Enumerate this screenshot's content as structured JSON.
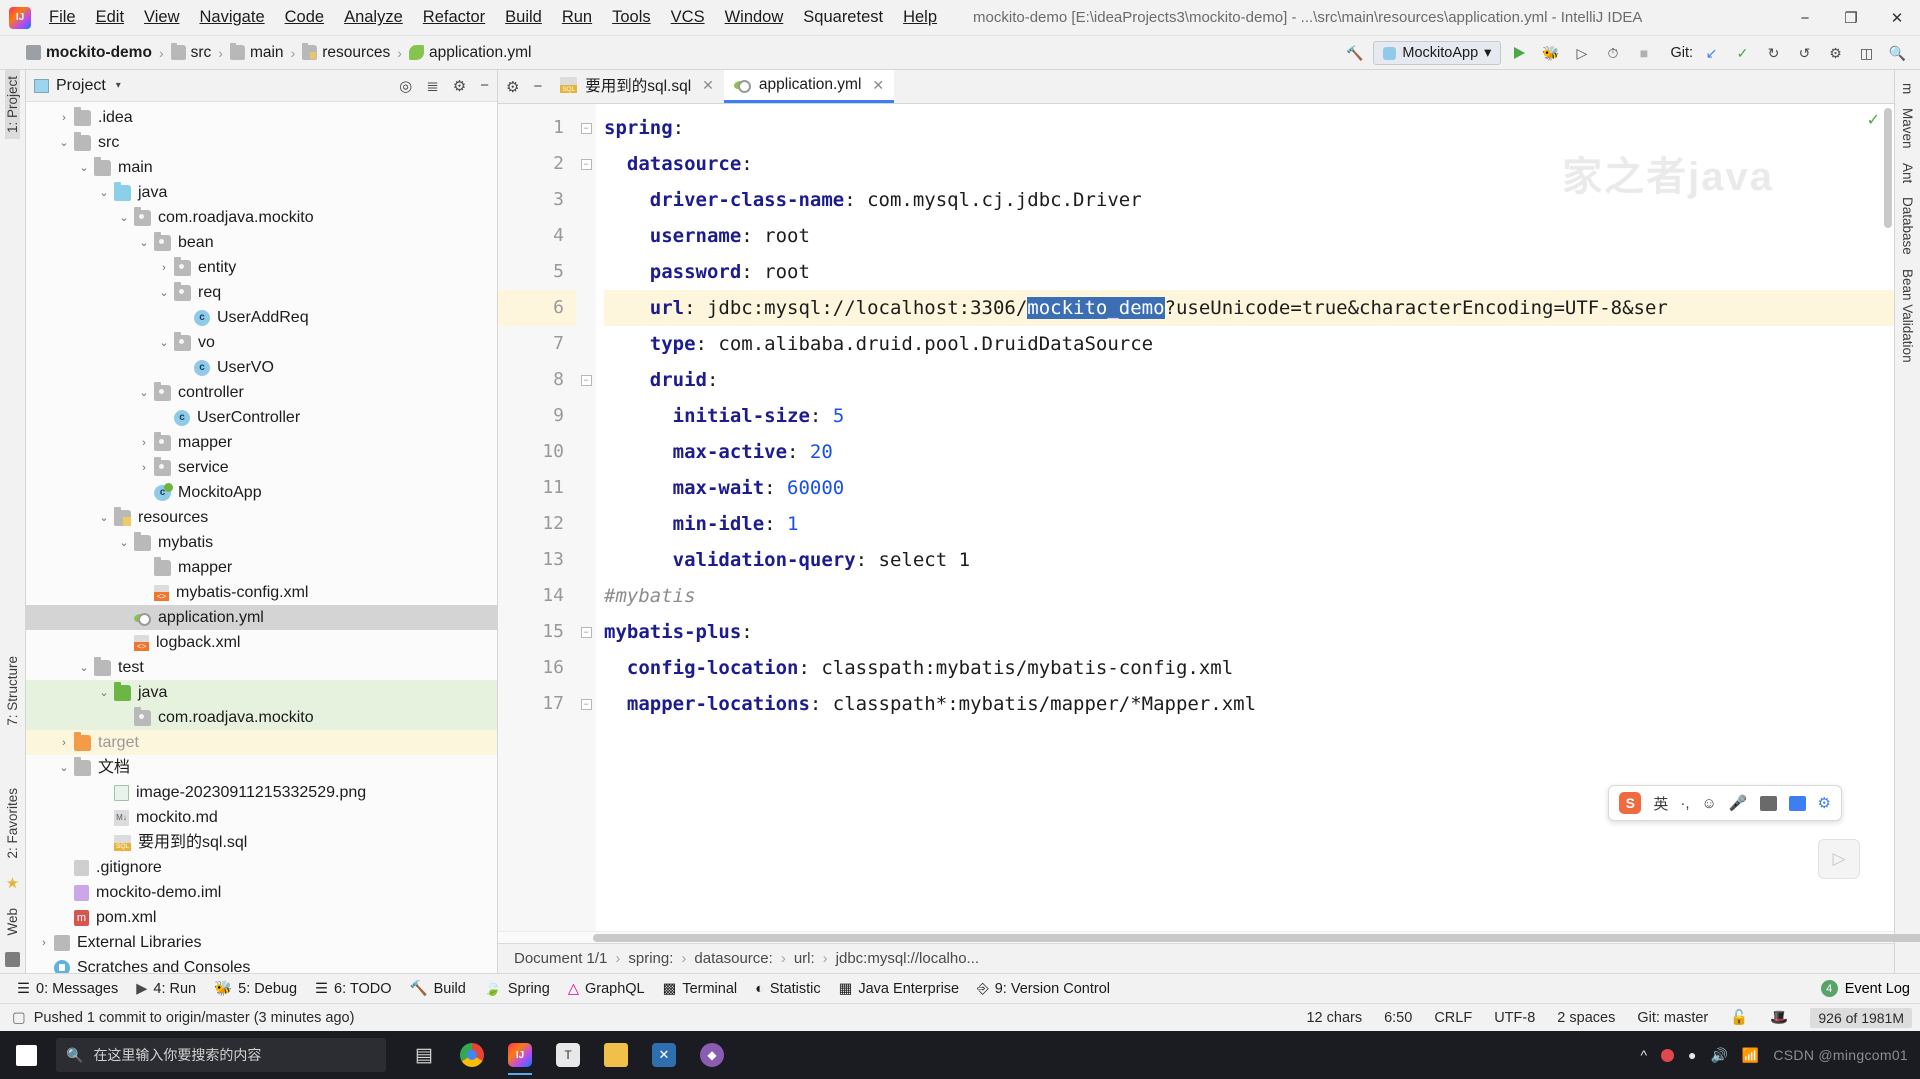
{
  "window": {
    "title": "mockito-demo [E:\\ideaProjects3\\mockito-demo] - ...\\src\\main\\resources\\application.yml - IntelliJ IDEA",
    "minimize": "−",
    "maximize": "❐",
    "close": "✕",
    "logo": "intellij-idea-logo"
  },
  "menu": {
    "items": [
      {
        "label": "File"
      },
      {
        "label": "Edit"
      },
      {
        "label": "View"
      },
      {
        "label": "Navigate"
      },
      {
        "label": "Code"
      },
      {
        "label": "Analyze"
      },
      {
        "label": "Refactor"
      },
      {
        "label": "Build"
      },
      {
        "label": "Run"
      },
      {
        "label": "Tools"
      },
      {
        "label": "VCS"
      },
      {
        "label": "Window"
      },
      {
        "label": "Squaretest"
      },
      {
        "label": "Help"
      }
    ]
  },
  "navbar": {
    "crumbs": [
      {
        "label": "mockito-demo",
        "icon": "project-folder-icon"
      },
      {
        "label": "src",
        "icon": "folder-icon"
      },
      {
        "label": "main",
        "icon": "folder-icon"
      },
      {
        "label": "resources",
        "icon": "resources-folder-icon"
      },
      {
        "label": "application.yml",
        "icon": "yml-file-icon"
      }
    ],
    "separator": "›",
    "run_config": "MockitoApp",
    "run_config_caret": "▾",
    "git_label": "Git:",
    "buttons": {
      "run": "run-button",
      "debug": "debug-button",
      "coverage": "run-with-coverage-button",
      "profiler": "profiler-button",
      "stop": "stop-button",
      "update": "update-project-button",
      "commit": "commit-button",
      "history": "history-button",
      "rollback": "rollback-button",
      "settings": "settings-button",
      "layout": "layout-button",
      "search": "search-everywhere-button"
    }
  },
  "left_rail": {
    "items": [
      {
        "label": "1: Project",
        "selected": true
      },
      {
        "label": "7: Structure",
        "selected": false
      },
      {
        "label": "2: Favorites",
        "selected": false
      },
      {
        "label": "Web",
        "selected": false
      }
    ]
  },
  "right_rail": {
    "items": [
      {
        "label": "m"
      },
      {
        "label": "Maven"
      },
      {
        "label": "Ant"
      },
      {
        "label": "Database"
      },
      {
        "label": "Bean Validation"
      }
    ]
  },
  "project_panel": {
    "title": "Project",
    "chevron": "▾",
    "icons": [
      "target-icon",
      "collapse-all-icon",
      "settings-gear-icon",
      "hide-icon"
    ],
    "tree": [
      {
        "indent": 1,
        "twisty": "›",
        "icon": "f-grey",
        "label": ".idea",
        "state": ""
      },
      {
        "indent": 1,
        "twisty": "⌄",
        "icon": "f-grey",
        "label": "src",
        "state": ""
      },
      {
        "indent": 2,
        "twisty": "⌄",
        "icon": "f-grey",
        "label": "main",
        "state": ""
      },
      {
        "indent": 3,
        "twisty": "⌄",
        "icon": "f-blue",
        "label": "java",
        "state": ""
      },
      {
        "indent": 4,
        "twisty": "⌄",
        "icon": "f-pkg",
        "label": "com.roadjava.mockito",
        "state": ""
      },
      {
        "indent": 5,
        "twisty": "⌄",
        "icon": "f-pkg",
        "label": "bean",
        "state": ""
      },
      {
        "indent": 6,
        "twisty": "›",
        "icon": "f-pkg",
        "label": "entity",
        "state": ""
      },
      {
        "indent": 6,
        "twisty": "⌄",
        "icon": "f-pkg",
        "label": "req",
        "state": ""
      },
      {
        "indent": 7,
        "twisty": "",
        "icon": "c-class",
        "label": "UserAddReq",
        "state": ""
      },
      {
        "indent": 6,
        "twisty": "⌄",
        "icon": "f-pkg",
        "label": "vo",
        "state": ""
      },
      {
        "indent": 7,
        "twisty": "",
        "icon": "c-class",
        "label": "UserVO",
        "state": ""
      },
      {
        "indent": 5,
        "twisty": "⌄",
        "icon": "f-pkg",
        "label": "controller",
        "state": ""
      },
      {
        "indent": 6,
        "twisty": "",
        "icon": "c-class",
        "label": "UserController",
        "state": ""
      },
      {
        "indent": 5,
        "twisty": "›",
        "icon": "f-pkg",
        "label": "mapper",
        "state": ""
      },
      {
        "indent": 5,
        "twisty": "›",
        "icon": "f-pkg",
        "label": "service",
        "state": ""
      },
      {
        "indent": 5,
        "twisty": "",
        "icon": "c-spring",
        "label": "MockitoApp",
        "state": ""
      },
      {
        "indent": 3,
        "twisty": "⌄",
        "icon": "f-res",
        "label": "resources",
        "state": ""
      },
      {
        "indent": 4,
        "twisty": "⌄",
        "icon": "f-grey",
        "label": "mybatis",
        "state": ""
      },
      {
        "indent": 5,
        "twisty": "",
        "icon": "f-grey",
        "label": "mapper",
        "state": ""
      },
      {
        "indent": 5,
        "twisty": "",
        "icon": "x-xml",
        "label": "mybatis-config.xml",
        "state": ""
      },
      {
        "indent": 4,
        "twisty": "",
        "icon": "y-yml",
        "label": "application.yml",
        "state": "selected"
      },
      {
        "indent": 4,
        "twisty": "",
        "icon": "x-xml",
        "label": "logback.xml",
        "state": ""
      },
      {
        "indent": 2,
        "twisty": "⌄",
        "icon": "f-grey",
        "label": "test",
        "state": ""
      },
      {
        "indent": 3,
        "twisty": "⌄",
        "icon": "f-green",
        "label": "java",
        "state": "green"
      },
      {
        "indent": 4,
        "twisty": "",
        "icon": "f-pkg",
        "label": "com.roadjava.mockito",
        "state": "green"
      },
      {
        "indent": 1,
        "twisty": "›",
        "icon": "f-orange",
        "label": "target",
        "state": "yellow",
        "dim": true
      },
      {
        "indent": 1,
        "twisty": "⌄",
        "icon": "f-grey",
        "label": "文档",
        "state": ""
      },
      {
        "indent": 3,
        "twisty": "",
        "icon": "i-png",
        "label": "image-20230911215332529.png",
        "state": ""
      },
      {
        "indent": 3,
        "twisty": "",
        "icon": "i-md",
        "label": "mockito.md",
        "state": ""
      },
      {
        "indent": 3,
        "twisty": "",
        "icon": "i-sql",
        "label": "要用到的sql.sql",
        "state": ""
      },
      {
        "indent": 1,
        "twisty": "",
        "icon": "i-git",
        "label": ".gitignore",
        "state": ""
      },
      {
        "indent": 1,
        "twisty": "",
        "icon": "i-iml",
        "label": "mockito-demo.iml",
        "state": ""
      },
      {
        "indent": 1,
        "twisty": "",
        "icon": "i-pom",
        "label": "pom.xml",
        "state": ""
      },
      {
        "indent": 0,
        "twisty": "›",
        "icon": "i-lib",
        "label": "External Libraries",
        "state": ""
      },
      {
        "indent": 0,
        "twisty": "",
        "icon": "i-scratch",
        "label": "Scratches and Consoles",
        "state": ""
      }
    ]
  },
  "editor": {
    "tabs": [
      {
        "label": "要用到的sql.sql",
        "icon": "sql-file-icon",
        "active": false,
        "close": "✕"
      },
      {
        "label": "application.yml",
        "icon": "yml-file-icon",
        "active": true,
        "close": "✕"
      }
    ],
    "tab_tools": {
      "settings": "⚙",
      "hide": "−"
    },
    "watermark": "家之者java",
    "inspection_ok": "✓",
    "line_numbers": [
      1,
      2,
      3,
      4,
      5,
      6,
      7,
      8,
      9,
      10,
      11,
      12,
      13,
      14,
      15,
      16,
      17
    ],
    "current_line": 6,
    "fold_lines": [
      1,
      2,
      8,
      15,
      17
    ],
    "lines": [
      {
        "n": 1,
        "segments": [
          {
            "t": "spring",
            "c": "k"
          },
          {
            "t": ":",
            "c": ""
          }
        ],
        "indent": 0
      },
      {
        "n": 2,
        "segments": [
          {
            "t": "datasource",
            "c": "k"
          },
          {
            "t": ":",
            "c": ""
          }
        ],
        "indent": 1
      },
      {
        "n": 3,
        "segments": [
          {
            "t": "driver-class-name",
            "c": "k"
          },
          {
            "t": ": com.mysql.cj.jdbc.Driver",
            "c": ""
          }
        ],
        "indent": 2
      },
      {
        "n": 4,
        "segments": [
          {
            "t": "username",
            "c": "k"
          },
          {
            "t": ": root",
            "c": ""
          }
        ],
        "indent": 2
      },
      {
        "n": 5,
        "segments": [
          {
            "t": "password",
            "c": "k"
          },
          {
            "t": ": root",
            "c": ""
          }
        ],
        "indent": 2
      },
      {
        "n": 6,
        "segments": [
          {
            "t": "url",
            "c": "k"
          },
          {
            "t": ": jdbc:mysql://localhost:3306/",
            "c": ""
          },
          {
            "t": "mockito_demo",
            "c": "sel"
          },
          {
            "t": "?useUnicode=true&characterEncoding=UTF-8&ser",
            "c": ""
          }
        ],
        "indent": 2
      },
      {
        "n": 7,
        "segments": [
          {
            "t": "type",
            "c": "k"
          },
          {
            "t": ": com.alibaba.druid.pool.DruidDataSource",
            "c": ""
          }
        ],
        "indent": 2
      },
      {
        "n": 8,
        "segments": [
          {
            "t": "druid",
            "c": "k"
          },
          {
            "t": ":",
            "c": ""
          }
        ],
        "indent": 2
      },
      {
        "n": 9,
        "segments": [
          {
            "t": "initial-size",
            "c": "k"
          },
          {
            "t": ": ",
            "c": ""
          },
          {
            "t": "5",
            "c": "num"
          }
        ],
        "indent": 3
      },
      {
        "n": 10,
        "segments": [
          {
            "t": "max-active",
            "c": "k"
          },
          {
            "t": ": ",
            "c": ""
          },
          {
            "t": "20",
            "c": "num"
          }
        ],
        "indent": 3
      },
      {
        "n": 11,
        "segments": [
          {
            "t": "max-wait",
            "c": "k"
          },
          {
            "t": ": ",
            "c": ""
          },
          {
            "t": "60000",
            "c": "num"
          }
        ],
        "indent": 3
      },
      {
        "n": 12,
        "segments": [
          {
            "t": "min-idle",
            "c": "k"
          },
          {
            "t": ": ",
            "c": ""
          },
          {
            "t": "1",
            "c": "num"
          }
        ],
        "indent": 3
      },
      {
        "n": 13,
        "segments": [
          {
            "t": "validation-query",
            "c": "k"
          },
          {
            "t": ": select 1",
            "c": ""
          }
        ],
        "indent": 3
      },
      {
        "n": 14,
        "segments": [
          {
            "t": "#mybatis",
            "c": "com"
          }
        ],
        "indent": 0
      },
      {
        "n": 15,
        "segments": [
          {
            "t": "mybatis-plus",
            "c": "k"
          },
          {
            "t": ":",
            "c": ""
          }
        ],
        "indent": 0
      },
      {
        "n": 16,
        "segments": [
          {
            "t": "config-location",
            "c": "k"
          },
          {
            "t": ": classpath:mybatis/mybatis-config.xml",
            "c": ""
          }
        ],
        "indent": 1
      },
      {
        "n": 17,
        "segments": [
          {
            "t": "mapper-locations",
            "c": "k"
          },
          {
            "t": ": classpath*:mybatis/mapper/*Mapper.xml",
            "c": ""
          }
        ],
        "indent": 1
      }
    ]
  },
  "doc_breadcrumbs": {
    "items": [
      "Document 1/1",
      "spring:",
      "datasource:",
      "url:",
      "jdbc:mysql://localho..."
    ],
    "separator": "›"
  },
  "tool_windows": {
    "items": [
      {
        "label": "0: Messages",
        "icon": "messages-icon",
        "mnemonic": "0"
      },
      {
        "label": "4: Run",
        "icon": "run-icon",
        "mnemonic": "4"
      },
      {
        "label": "5: Debug",
        "icon": "debug-icon",
        "mnemonic": "5"
      },
      {
        "label": "6: TODO",
        "icon": "todo-icon",
        "mnemonic": "6"
      },
      {
        "label": "Build",
        "icon": "build-icon",
        "mnemonic": ""
      },
      {
        "label": "Spring",
        "icon": "spring-icon",
        "mnemonic": ""
      },
      {
        "label": "GraphQL",
        "icon": "graphql-icon",
        "mnemonic": ""
      },
      {
        "label": "Terminal",
        "icon": "terminal-icon",
        "mnemonic": ""
      },
      {
        "label": "Statistic",
        "icon": "statistic-icon",
        "mnemonic": ""
      },
      {
        "label": "Java Enterprise",
        "icon": "java-enterprise-icon",
        "mnemonic": ""
      },
      {
        "label": "9: Version Control",
        "icon": "version-control-icon",
        "mnemonic": "9"
      }
    ],
    "event_log": {
      "count": "4",
      "label": "Event Log"
    }
  },
  "statusbar": {
    "message": "Pushed 1 commit to origin/master (3 minutes ago)",
    "message_icon": "notification-icon",
    "chars": "12 chars",
    "caret": "6:50",
    "line_sep": "CRLF",
    "encoding": "UTF-8",
    "indent": "2 spaces",
    "git_branch": "Git: master",
    "lock_icon": "unlocked-icon",
    "inspector_icon": "hector-icon",
    "memory": "926 of 1981M"
  },
  "ime": {
    "logo": "sogou-ime-logo",
    "mode": "英",
    "punctuation": "·,",
    "emoji_icon": "emoji-icon",
    "mic_icon": "microphone-icon",
    "keyboard_icon": "keyboard-icon",
    "apps_icon": "apps-icon",
    "settings_icon": "ime-settings-icon"
  },
  "taskbar": {
    "start_icon": "windows-start-icon",
    "search_placeholder": "在这里输入你要搜索的内容",
    "search_icon": "search-icon",
    "apps": [
      {
        "name": "task-view-icon",
        "glyph": "❑",
        "color": "#dfdfdf",
        "active": false
      },
      {
        "name": "chrome-icon",
        "glyph": "",
        "color": "#4285f4",
        "active": false
      },
      {
        "name": "intellij-idea-taskbar-icon",
        "glyph": "IJ",
        "color": "#f97a12",
        "active": true
      },
      {
        "name": "typora-icon",
        "glyph": "T",
        "color": "#d8d8d8",
        "active": false
      },
      {
        "name": "file-explorer-icon",
        "glyph": "🗀",
        "color": "#f0c04a",
        "active": false
      },
      {
        "name": "xshell-icon",
        "glyph": "✕",
        "color": "#2f6fb0",
        "active": false
      },
      {
        "name": "navicat-icon",
        "glyph": "◆",
        "color": "#8b5db2",
        "active": false
      }
    ],
    "tray": {
      "chevron": "⌃",
      "record_icon": "record-icon",
      "camera_icon": "camera-icon",
      "volume_icon": "volume-icon",
      "network_icon": "network-icon",
      "watermark": "CSDN @mingcom01"
    }
  }
}
